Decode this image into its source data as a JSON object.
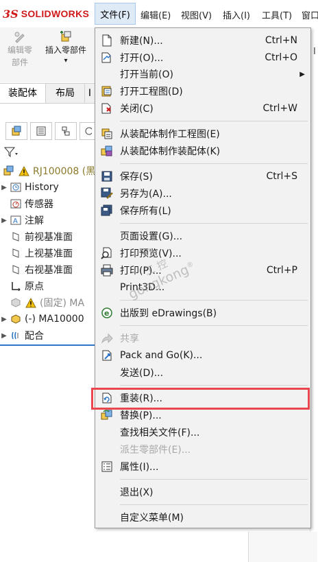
{
  "app": {
    "logo_mark": "3S",
    "logo_text": "SOLIDWORKS"
  },
  "menubar": {
    "file": "文件(F)",
    "edit": "编辑(E)",
    "view": "视图(V)",
    "insert": "插入(I)",
    "tools": "工具(T)",
    "window": "窗口"
  },
  "toolbar": {
    "edit_part_line1": "编辑零",
    "edit_part_line2": "部件",
    "insert_part": "插入零部件",
    "insert_arrow": "▾"
  },
  "tabs": {
    "assembly": "装配体",
    "layout": "布局",
    "third": "I"
  },
  "tree": {
    "root": "RJ100008 (黑",
    "history": "History",
    "sensors": "传感器",
    "annotations": "注解",
    "front_plane": "前视基准面",
    "top_plane": "上视基准面",
    "right_plane": "右视基准面",
    "origin": "原点",
    "fixed_part": "(固定) MA",
    "part2": "(-) MA10000",
    "mates": "配合"
  },
  "menu": {
    "new": "新建(N)...",
    "new_sc": "Ctrl+N",
    "open": "打开(O)...",
    "open_sc": "Ctrl+O",
    "open_current": "打开当前(O)",
    "open_drawing": "打开工程图(D)",
    "close": "关闭(C)",
    "close_sc": "Ctrl+W",
    "make_drawing": "从装配体制作工程图(E)",
    "make_assembly": "从装配体制作装配体(K)",
    "save": "保存(S)",
    "save_sc": "Ctrl+S",
    "save_as": "另存为(A)...",
    "save_all": "保存所有(L)",
    "page_setup": "页面设置(G)...",
    "print_preview": "打印预览(V)...",
    "print": "打印(P)...",
    "print_sc": "Ctrl+P",
    "print3d": "Print3D...",
    "publish_edrawings": "出版到 eDrawings(B)",
    "share": "共享",
    "pack_and_go": "Pack and Go(K)...",
    "send": "发送(D)...",
    "reload": "重装(R)...",
    "replace": "替换(P)...",
    "find_references": "查找相关文件(F)...",
    "derive_part": "派生零部件(E)...",
    "properties": "属性(I)...",
    "exit": "退出(X)",
    "customize_menu": "自定义菜单(M)"
  },
  "watermark": {
    "line1": "工 控",
    "line2": "gongkong",
    "reg": "®"
  },
  "colors": {
    "highlight": "#e8474e",
    "brand": "#d0191b",
    "tree_accent": "#2e75c7"
  }
}
